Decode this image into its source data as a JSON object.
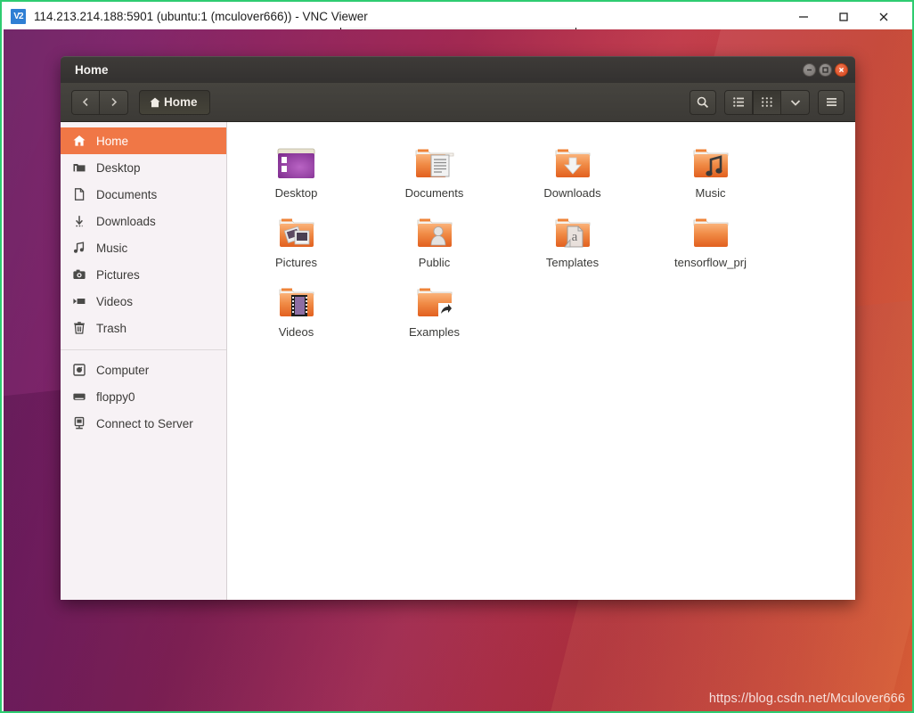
{
  "vnc": {
    "app_icon": "vnc-logo-icon",
    "title": "114.213.214.188:5901 (ubuntu:1 (mculover666)) - VNC Viewer",
    "controls": [
      {
        "name": "minimize",
        "glyph": "—"
      },
      {
        "name": "maximize",
        "glyph": "☐"
      },
      {
        "name": "close",
        "glyph": "✕"
      }
    ]
  },
  "file_manager": {
    "title": "Home",
    "window_controls": [
      {
        "name": "minimize",
        "glyph": "–"
      },
      {
        "name": "maximize",
        "glyph": "□"
      },
      {
        "name": "close",
        "glyph": "✕"
      }
    ],
    "toolbar": {
      "back_label": "‹",
      "forward_label": "›",
      "breadcrumb_label": "Home",
      "breadcrumb_icon": "home-icon",
      "search_icon": "search-icon",
      "list_view_icon": "list-view-icon",
      "grid_view_icon": "grid-view-icon",
      "view_options_icon": "chevron-down-icon",
      "menu_icon": "hamburger-menu-icon"
    },
    "sidebar": {
      "places": [
        {
          "label": "Home",
          "icon": "home-icon",
          "selected": true
        },
        {
          "label": "Desktop",
          "icon": "desktop-folder-icon",
          "selected": false
        },
        {
          "label": "Documents",
          "icon": "document-icon",
          "selected": false
        },
        {
          "label": "Downloads",
          "icon": "download-icon",
          "selected": false
        },
        {
          "label": "Music",
          "icon": "music-note-icon",
          "selected": false
        },
        {
          "label": "Pictures",
          "icon": "camera-icon",
          "selected": false
        },
        {
          "label": "Videos",
          "icon": "video-icon",
          "selected": false
        },
        {
          "label": "Trash",
          "icon": "trash-icon",
          "selected": false
        }
      ],
      "devices": [
        {
          "label": "Computer",
          "icon": "computer-disk-icon"
        },
        {
          "label": "floppy0",
          "icon": "floppy-icon"
        },
        {
          "label": "Connect to Server",
          "icon": "server-connect-icon"
        }
      ]
    },
    "files": [
      {
        "label": "Desktop",
        "icon": "desktop-window-icon"
      },
      {
        "label": "Documents",
        "icon": "folder-documents-icon"
      },
      {
        "label": "Downloads",
        "icon": "folder-downloads-icon"
      },
      {
        "label": "Music",
        "icon": "folder-music-icon"
      },
      {
        "label": "Pictures",
        "icon": "folder-pictures-icon"
      },
      {
        "label": "Public",
        "icon": "folder-public-icon"
      },
      {
        "label": "Templates",
        "icon": "folder-templates-icon"
      },
      {
        "label": "tensorflow_prj",
        "icon": "folder-plain-icon"
      },
      {
        "label": "Videos",
        "icon": "folder-videos-icon"
      },
      {
        "label": "Examples",
        "icon": "folder-symlink-icon"
      }
    ]
  },
  "desktop": {
    "watermark": "https://blog.csdn.net/Mculover666"
  },
  "colors": {
    "accent_orange": "#f07746",
    "close_red": "#d64a22",
    "titlebar_dark": "#3a3833",
    "sidebar_bg": "#f7f2f5",
    "frame_green": "#2ecc71"
  }
}
